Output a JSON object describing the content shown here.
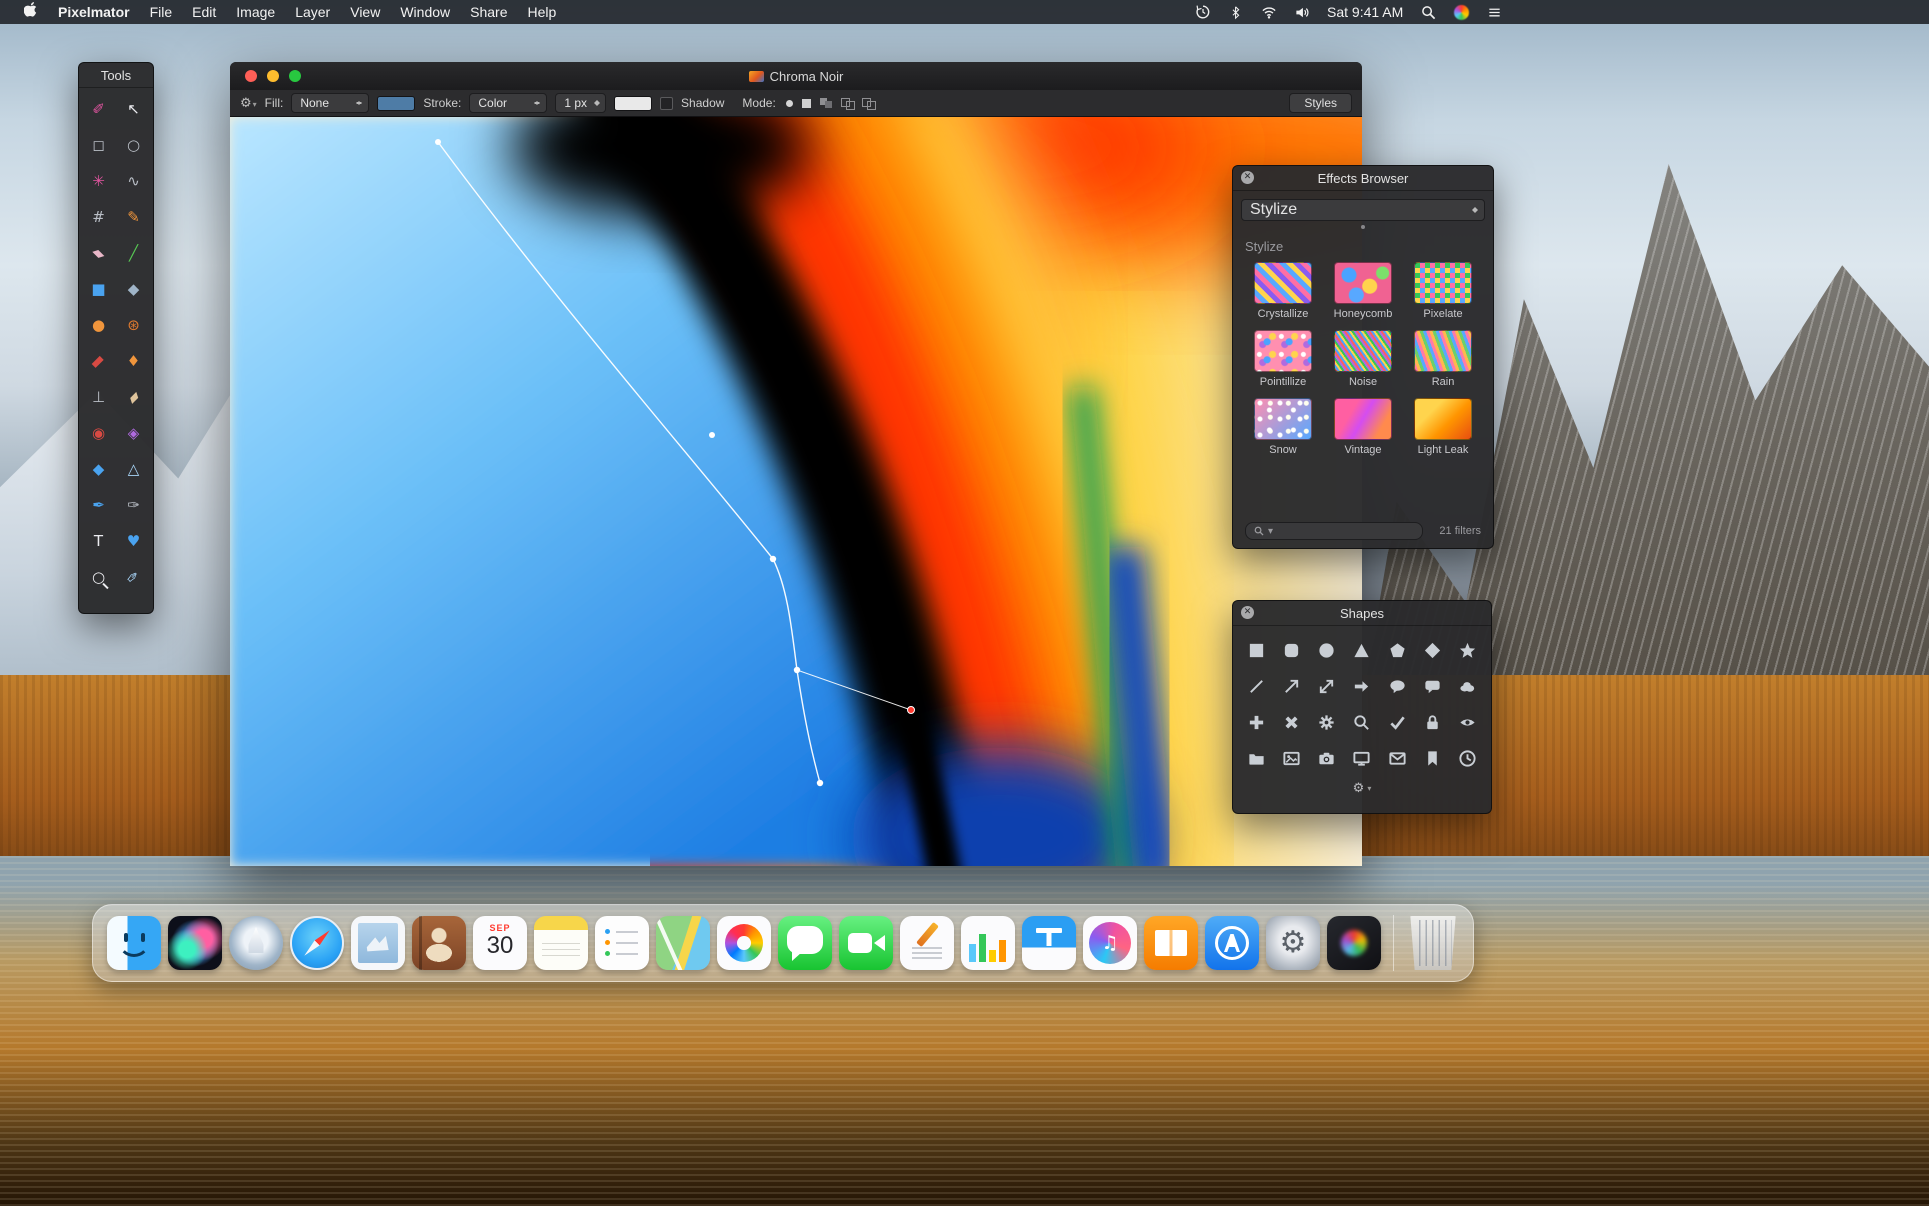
{
  "menubar": {
    "app_name": "Pixelmator",
    "menus": [
      "File",
      "Edit",
      "Image",
      "Layer",
      "View",
      "Window",
      "Share",
      "Help"
    ],
    "clock": "Sat 9:41 AM",
    "status_icons": [
      "time-machine",
      "bluetooth",
      "wifi",
      "volume",
      "spotlight",
      "siri",
      "notification-center"
    ]
  },
  "tools_panel": {
    "title": "Tools",
    "items": [
      {
        "name": "arrange-tool",
        "glyph": "✐"
      },
      {
        "name": "pointer-tool",
        "glyph": "↖"
      },
      {
        "name": "rect-select-tool",
        "glyph": "◻"
      },
      {
        "name": "ellipse-select-tool",
        "glyph": "○"
      },
      {
        "name": "quick-select-tool",
        "glyph": "✳"
      },
      {
        "name": "lasso-tool",
        "glyph": "∿"
      },
      {
        "name": "crop-tool",
        "glyph": "#"
      },
      {
        "name": "pencil-tool",
        "glyph": "✎"
      },
      {
        "name": "eraser-tool",
        "glyph": "▰"
      },
      {
        "name": "line-tool",
        "glyph": "╱"
      },
      {
        "name": "color-fill-tool",
        "glyph": "■"
      },
      {
        "name": "paint-bucket-tool",
        "glyph": "◆"
      },
      {
        "name": "gradient-tool",
        "glyph": "●"
      },
      {
        "name": "smudge-tool",
        "glyph": "⊛"
      },
      {
        "name": "brush-tool",
        "glyph": "▮"
      },
      {
        "name": "warp-tool",
        "glyph": "♦"
      },
      {
        "name": "clone-stamp-tool",
        "glyph": "⊥"
      },
      {
        "name": "healing-tool",
        "glyph": "▰"
      },
      {
        "name": "red-eye-tool",
        "glyph": "◉"
      },
      {
        "name": "sponge-tool",
        "glyph": "◈"
      },
      {
        "name": "blur-tool",
        "glyph": "◆"
      },
      {
        "name": "sharpen-tool",
        "glyph": "△"
      },
      {
        "name": "pen-tool",
        "glyph": "✒"
      },
      {
        "name": "freeform-pen-tool",
        "glyph": "✑"
      },
      {
        "name": "type-tool",
        "glyph": "T"
      },
      {
        "name": "shape-tool",
        "glyph": "♥"
      },
      {
        "name": "zoom-tool",
        "glyph": "○"
      },
      {
        "name": "eyedropper-tool",
        "glyph": "✑"
      }
    ]
  },
  "window": {
    "title": "Chroma Noir",
    "toolbar": {
      "fill_label": "Fill:",
      "fill_value": "None",
      "fill_swatch": "#4e7ca6",
      "stroke_label": "Stroke:",
      "stroke_value": "Color",
      "stroke_width": "1 px",
      "stroke_swatch": "#e9e9e9",
      "shadow_label": "Shadow",
      "mode_label": "Mode:",
      "styles_label": "Styles"
    }
  },
  "effects_browser": {
    "title": "Effects Browser",
    "category": "Stylize",
    "section": "Stylize",
    "effects": [
      "Crystallize",
      "Honeycomb",
      "Pixelate",
      "Pointillize",
      "Noise",
      "Rain",
      "Snow",
      "Vintage",
      "Light Leak"
    ],
    "filters_count": "21 filters"
  },
  "shapes_panel": {
    "title": "Shapes",
    "shapes": [
      "square",
      "rounded-square",
      "circle",
      "triangle",
      "pentagon",
      "diamond",
      "star",
      "line",
      "arrow-up-right",
      "arrow-double",
      "arrow-right",
      "speech-bubble-round",
      "speech-bubble-rect",
      "cloud",
      "plus",
      "cross",
      "gear",
      "magnifier",
      "checkmark",
      "lock",
      "eye",
      "folder",
      "picture",
      "camera",
      "display",
      "envelope",
      "bookmark",
      "clock"
    ]
  },
  "dock": {
    "apps": [
      "Finder",
      "Siri",
      "Launchpad",
      "Safari",
      "Mail",
      "Contacts",
      "Calendar",
      "Notes",
      "Reminders",
      "Maps",
      "Photos",
      "Messages",
      "FaceTime",
      "Pages",
      "Numbers",
      "Keynote",
      "iTunes",
      "iBooks",
      "App Store",
      "System Preferences",
      "Pixelmator",
      "Trash"
    ],
    "calendar": {
      "month": "SEP",
      "day": "30"
    }
  },
  "canvas": {
    "palette": [
      "#a8e0ff",
      "#1f7fe0",
      "#000000",
      "#ff2e00",
      "#ff9100",
      "#ffd93a",
      "#f6ecd8",
      "#0f9e55",
      "#0d47c0"
    ]
  }
}
